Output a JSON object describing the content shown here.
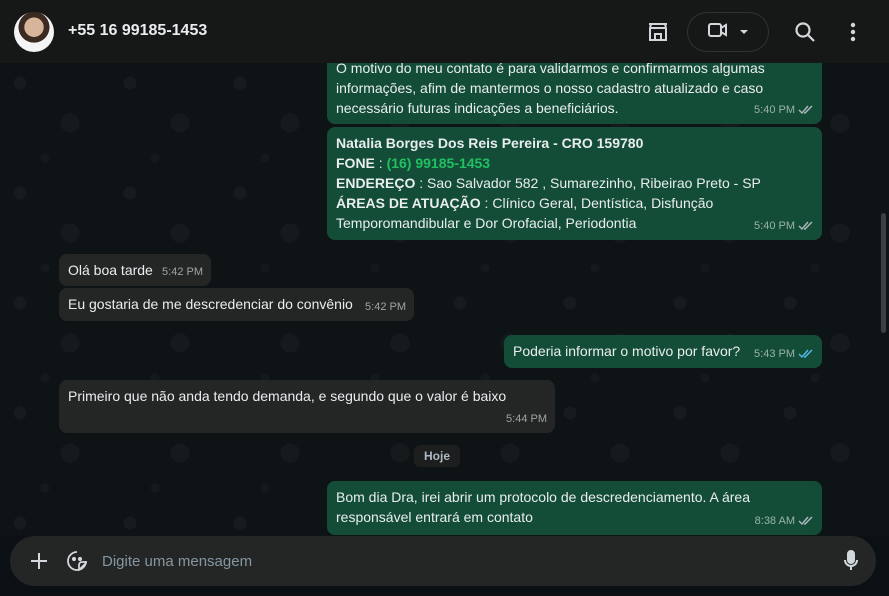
{
  "header": {
    "contact_name": "+55 16 99185-1453",
    "icons": [
      "store-icon",
      "video-call-icon",
      "chevron-down-icon",
      "search-icon",
      "menu-icon"
    ]
  },
  "messages": {
    "m1": {
      "lines": [
        "O motivo do meu contato é para validarmos e confirmarmos algumas",
        "informações, afim de mantermos o nosso cadastro atualizado e caso",
        "necessário futuras indicações a beneficiários."
      ],
      "time": "5:40 PM"
    },
    "m2": {
      "title": "Natalia Borges Dos Reis Pereira - CRO 159780",
      "phone_label": "FONE",
      "phone_value": "(16) 99185-1453",
      "address_label": "ENDEREÇO",
      "address_value": "Sao Salvador 582 , Sumarezinho, Ribeirao Preto - SP",
      "areas_label": "ÁREAS DE ATUAÇÃO",
      "areas_value_1": "Clínico Geral, Dentística, Disfunção",
      "areas_value_2": "Temporomandibular e Dor Orofacial, Periodontia",
      "time": "5:40 PM"
    },
    "m3": {
      "text": "Olá boa tarde",
      "time": "5:42 PM"
    },
    "m4": {
      "text": "Eu gostaria de me descredenciar do convênio",
      "time": "5:42 PM"
    },
    "m5": {
      "text": "Poderia informar o motivo por favor?",
      "time": "5:43 PM"
    },
    "m6": {
      "text": "Primeiro que não anda tendo demanda, e segundo que o valor é baixo",
      "time": "5:44 PM"
    },
    "date_divider": "Hoje",
    "m7": {
      "lines": [
        "Bom dia Dra, irei abrir um protocolo de descredenciamento. A área",
        "responsável entrará em contato"
      ],
      "time": "8:38 AM"
    }
  },
  "colors": {
    "outgoing_bubble": "#144d37",
    "incoming_bubble": "#242626",
    "read_ticks": "#53bdeb",
    "delivered_ticks": "#aebac1",
    "accent_green": "#21c063"
  },
  "composer": {
    "placeholder": "Digite uma mensagem",
    "icons": [
      "plus-icon",
      "sticker-icon",
      "mic-icon"
    ]
  }
}
